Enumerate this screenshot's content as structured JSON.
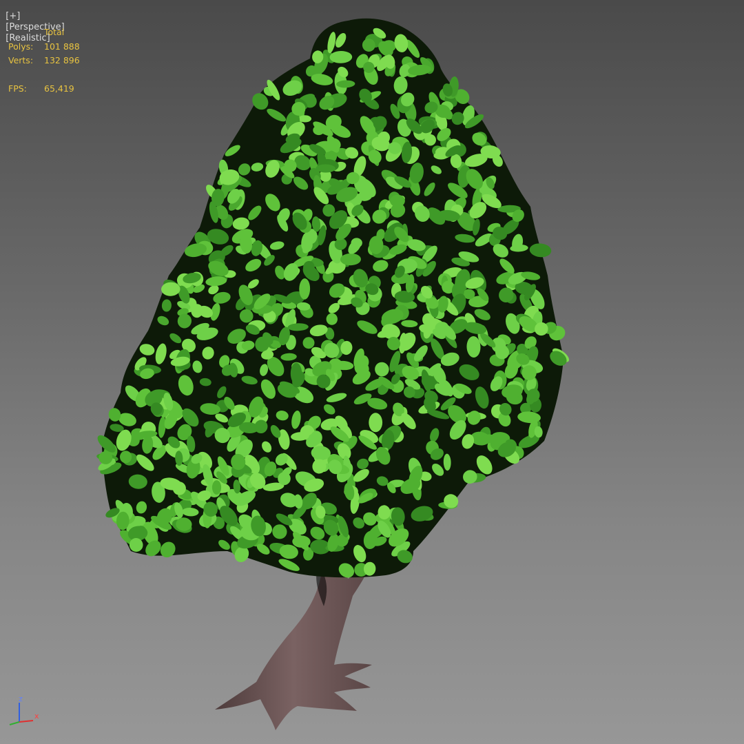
{
  "viewport": {
    "menu_label": "[+]",
    "view_label": "[Perspective]",
    "shading_label": "[Realistic]"
  },
  "stats": {
    "header": "Total",
    "polys_label": "Polys:",
    "polys_value": "101 888",
    "verts_label": "Verts:",
    "verts_value": "132 896",
    "fps_label": "FPS:",
    "fps_value": "65,419"
  },
  "axis_gizmo": {
    "z_label": "z",
    "x_label": "x",
    "colors": {
      "x": "#e03030",
      "y": "#30b030",
      "z": "#3060e0"
    }
  },
  "scene": {
    "object": "tree-model",
    "colors": {
      "leaf": "#4fb030",
      "leaf_light": "#7fdc50",
      "trunk": "#6e5656"
    }
  }
}
